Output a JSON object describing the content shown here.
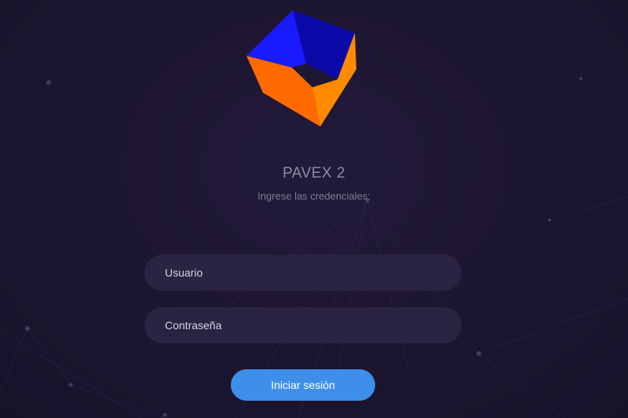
{
  "app": {
    "title": "PAVEX 2",
    "subtitle": "Ingrese las credenciales:",
    "logo_icon": "cube-logo-icon"
  },
  "form": {
    "username_placeholder": "Usuario",
    "password_placeholder": "Contraseña",
    "submit_label": "Iniciar sesión"
  },
  "colors": {
    "background": "#1c1530",
    "field_background": "#2a2342",
    "button": "#3d8fea",
    "logo_blue": "#1a1aff",
    "logo_orange": "#ff7a00"
  }
}
